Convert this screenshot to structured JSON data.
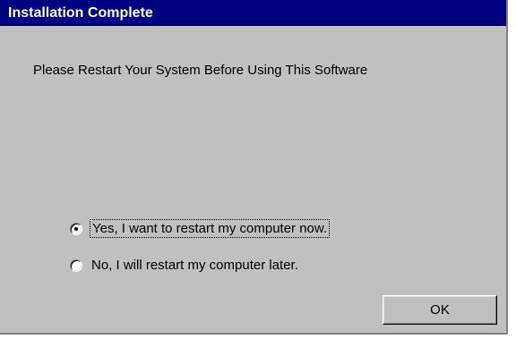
{
  "window": {
    "title": "Installation Complete"
  },
  "dialog": {
    "message": "Please Restart Your System Before Using This Software",
    "options": [
      {
        "label": "Yes, I want to restart my computer now.",
        "selected": true
      },
      {
        "label": "No, I will restart my computer later.",
        "selected": false
      }
    ],
    "ok_label": "OK"
  },
  "colors": {
    "titlebar": "#000080",
    "face": "#c0c0c0"
  },
  "icons": {
    "radio_selected": "radio-selected-icon",
    "radio_unselected": "radio-unselected-icon"
  }
}
